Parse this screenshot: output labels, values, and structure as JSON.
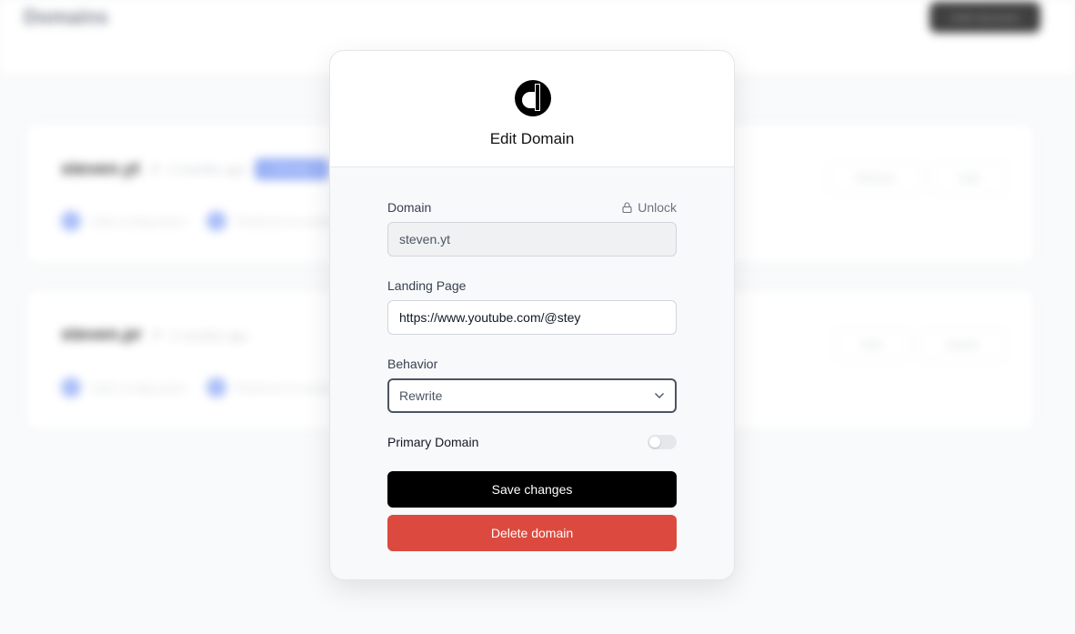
{
  "background": {
    "page_title": "Domains",
    "add_button_label": "Add domain",
    "domains": [
      {
        "name": "steven.yt",
        "date": "2 months ago",
        "badge": "Primary",
        "statuses": [
          "Valid configuration",
          "Redirects to website"
        ],
        "actions": [
          "Refresh",
          "Edit"
        ]
      },
      {
        "name": "steven.pr",
        "date": "2 months ago",
        "badge": null,
        "statuses": [
          "Valid configuration",
          "Redirects to website"
        ],
        "actions": [
          "Edit",
          "Delete"
        ]
      }
    ]
  },
  "modal": {
    "logo_icon": "dub-logo-icon",
    "title": "Edit Domain",
    "domain": {
      "label": "Domain",
      "value": "steven.yt",
      "unlock_label": "Unlock",
      "unlock_icon": "lock-icon"
    },
    "landing_page": {
      "label": "Landing Page",
      "value": "https://www.youtube.com/@stey"
    },
    "behavior": {
      "label": "Behavior",
      "selected": "Rewrite",
      "chevron_icon": "chevron-down-icon"
    },
    "primary_domain": {
      "label": "Primary Domain",
      "enabled": false
    },
    "save_label": "Save changes",
    "delete_label": "Delete domain"
  },
  "colors": {
    "save_button": "#000000",
    "delete_button": "#dc4a3f",
    "badge": "#8aa5f5",
    "status_dot": "#9db4f8"
  }
}
